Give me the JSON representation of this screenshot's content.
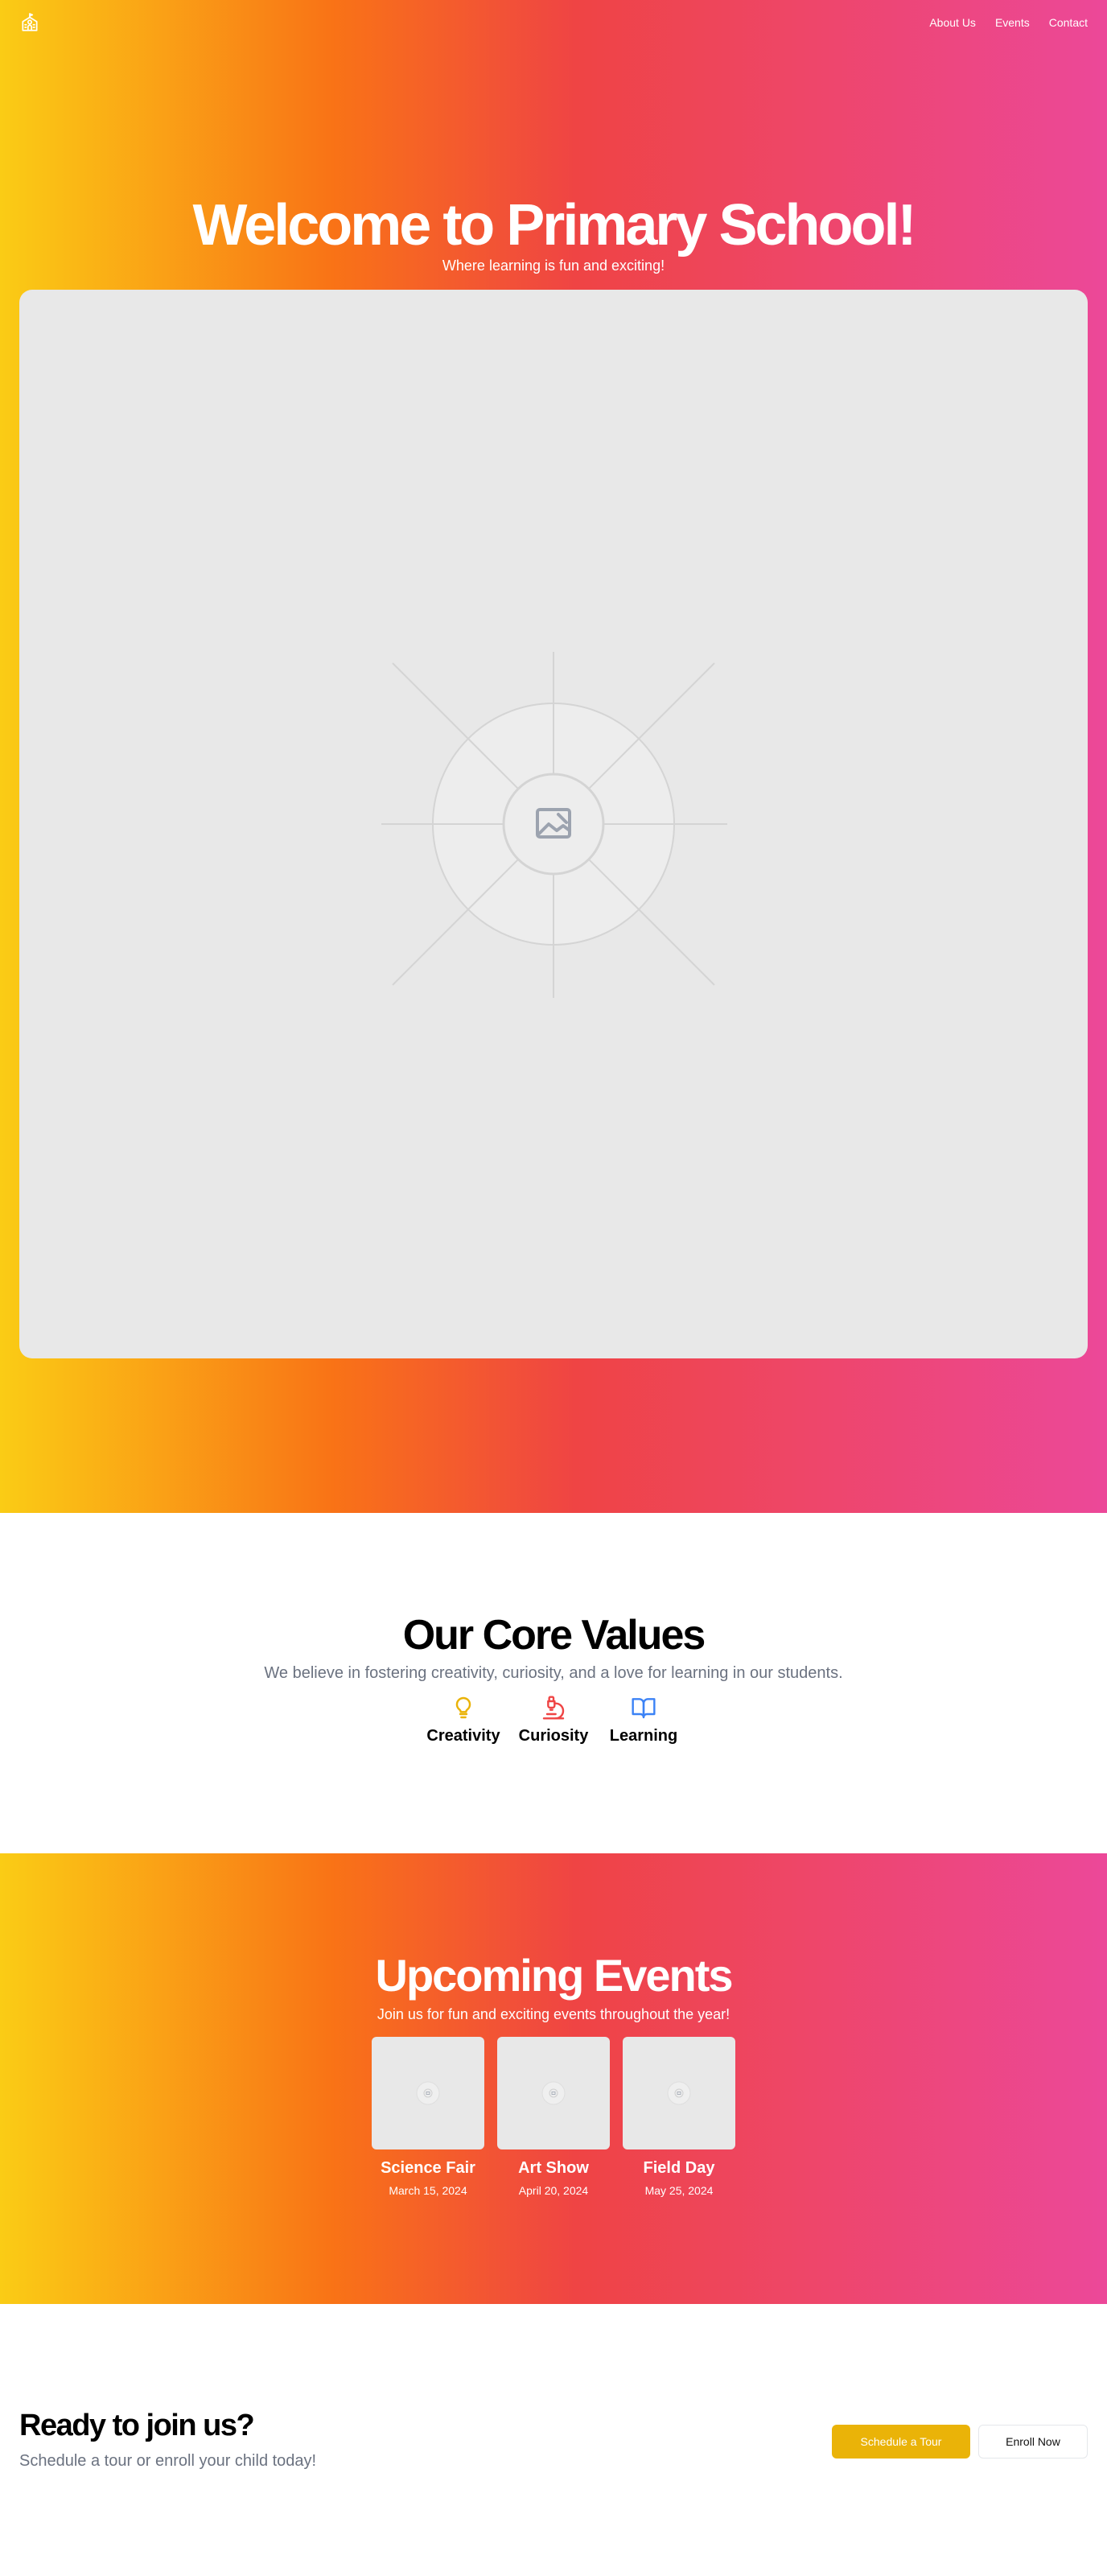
{
  "nav": {
    "logo_icon": "school-icon",
    "links": [
      "About Us",
      "Events",
      "Contact"
    ]
  },
  "hero": {
    "title": "Welcome to Primary School!",
    "subtitle": "Where learning is fun and exciting!",
    "image_icon": "image-placeholder-icon"
  },
  "values": {
    "title": "Our Core Values",
    "subtitle": "We believe in fostering creativity, curiosity, and a love for learning in our students.",
    "items": [
      {
        "label": "Creativity",
        "icon": "lightbulb-icon",
        "color": "#eab308"
      },
      {
        "label": "Curiosity",
        "icon": "microscope-icon",
        "color": "#ef4444"
      },
      {
        "label": "Learning",
        "icon": "book-open-icon",
        "color": "#3b82f6"
      }
    ]
  },
  "events": {
    "title": "Upcoming Events",
    "subtitle": "Join us for fun and exciting events throughout the year!",
    "items": [
      {
        "name": "Science Fair",
        "date": "March 15, 2024"
      },
      {
        "name": "Art Show",
        "date": "April 20, 2024"
      },
      {
        "name": "Field Day",
        "date": "May 25, 2024"
      }
    ]
  },
  "cta": {
    "title": "Ready to join us?",
    "subtitle": "Schedule a tour or enroll your child today!",
    "primary_button": "Schedule a Tour",
    "secondary_button": "Enroll Now"
  },
  "colors": {
    "gradient": [
      "#facc15",
      "#f97316",
      "#ef4444",
      "#ec4899"
    ],
    "primary_button": "#eab308",
    "muted_text": "#6b7280"
  }
}
